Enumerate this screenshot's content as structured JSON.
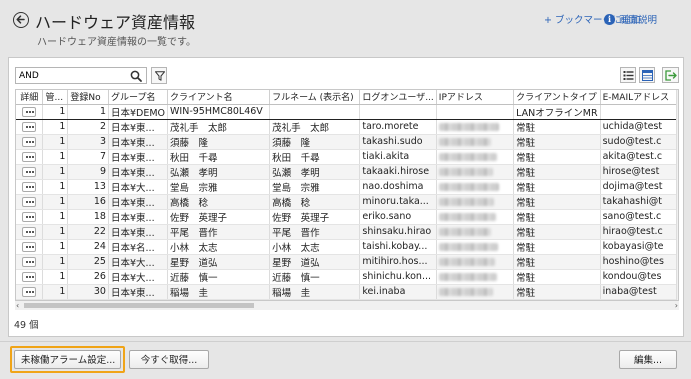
{
  "header": {
    "title": "ハードウェア資産情報",
    "subtitle": "ハードウェア資産情報の一覧です。",
    "bookmark_link": "+ ブックマークに追加",
    "help_link": "画面説明"
  },
  "toolbar": {
    "search_value": "AND",
    "search_placeholder": ""
  },
  "grid": {
    "columns": [
      "詳細",
      "管...",
      "登録No",
      "グループ名",
      "クライアント名",
      "フルネーム (表示名)",
      "ログオンユーザ...",
      "IPアドレス",
      "クライアントタイプ",
      "E-MAILアドレス"
    ],
    "rows": [
      {
        "m": "1",
        "no": "1",
        "group": "日本¥DEMO",
        "client": "WIN-95HMC80L46V",
        "fullname": "",
        "logon": "",
        "type": "LANオフラインMR",
        "email": ""
      },
      {
        "m": "1",
        "no": "2",
        "group": "日本¥東...",
        "client": "茂礼手　太郎",
        "fullname": "茂礼手　太郎",
        "logon": "taro.morete",
        "type": "常駐",
        "email": "uchida@test"
      },
      {
        "m": "1",
        "no": "3",
        "group": "日本¥東...",
        "client": "須藤　隆",
        "fullname": "須藤　隆",
        "logon": "takashi.sudo",
        "type": "常駐",
        "email": "sudo@test.c"
      },
      {
        "m": "1",
        "no": "7",
        "group": "日本¥東...",
        "client": "秋田　千尋",
        "fullname": "秋田　千尋",
        "logon": "tiaki.akita",
        "type": "常駐",
        "email": "akita@test.c"
      },
      {
        "m": "1",
        "no": "9",
        "group": "日本¥東...",
        "client": "弘瀬　孝明",
        "fullname": "弘瀬　孝明",
        "logon": "takaaki.hirose",
        "type": "常駐",
        "email": "hirose@test"
      },
      {
        "m": "1",
        "no": "13",
        "group": "日本¥大...",
        "client": "堂島　宗雅",
        "fullname": "堂島　宗雅",
        "logon": "nao.doshima",
        "type": "常駐",
        "email": "dojima@test"
      },
      {
        "m": "1",
        "no": "16",
        "group": "日本¥東...",
        "client": "高橋　稔",
        "fullname": "高橋　稔",
        "logon": "minoru.taka...",
        "type": "常駐",
        "email": "takahashi@t"
      },
      {
        "m": "1",
        "no": "18",
        "group": "日本¥東...",
        "client": "佐野　英理子",
        "fullname": "佐野　英理子",
        "logon": "eriko.sano",
        "type": "常駐",
        "email": "sano@test.c"
      },
      {
        "m": "1",
        "no": "22",
        "group": "日本¥東...",
        "client": "平尾　晋作",
        "fullname": "平尾　晋作",
        "logon": "shinsaku.hirao",
        "type": "常駐",
        "email": "hirao@test.c"
      },
      {
        "m": "1",
        "no": "24",
        "group": "日本¥名...",
        "client": "小林　太志",
        "fullname": "小林　太志",
        "logon": "taishi.kobay...",
        "type": "常駐",
        "email": "kobayasi@te"
      },
      {
        "m": "1",
        "no": "25",
        "group": "日本¥大...",
        "client": "星野　道弘",
        "fullname": "星野　道弘",
        "logon": "mitihiro.hos...",
        "type": "常駐",
        "email": "hoshino@tes"
      },
      {
        "m": "1",
        "no": "26",
        "group": "日本¥大...",
        "client": "近藤　慎一",
        "fullname": "近藤　慎一",
        "logon": "shinichu.kon...",
        "type": "常駐",
        "email": "kondou@tes"
      },
      {
        "m": "1",
        "no": "30",
        "group": "日本¥東...",
        "client": "稲場　圭",
        "fullname": "稲場　圭",
        "logon": "kei.inaba",
        "type": "常駐",
        "email": "inaba@test"
      }
    ]
  },
  "footer": {
    "count_text": "49 個",
    "alarm_button": "未稼働アラーム設定...",
    "fetch_button": "今すぐ取得...",
    "edit_button": "編集..."
  },
  "icons": {
    "back": "back-arrow-icon",
    "search": "search-icon",
    "filter": "filter-icon",
    "list_view": "list-view-icon",
    "grid_view": "grid-view-icon",
    "export": "export-icon",
    "help": "info-icon"
  },
  "colors": {
    "link": "#2b63b7",
    "focus": "#f0a417",
    "background": "#e6e6e6"
  }
}
